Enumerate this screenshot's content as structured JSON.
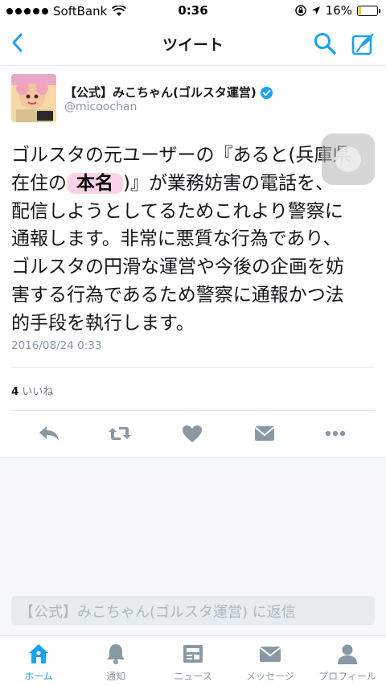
{
  "status_bar": {
    "carrier": "SoftBank",
    "time": "0:36",
    "battery": "16%",
    "battery_level": 0.16
  },
  "nav": {
    "title": "ツイート"
  },
  "tweet": {
    "display_name": "【公式】みこちゃん(ゴルスタ運営)",
    "handle": "@micoochan",
    "line1": "ゴルスタの元ユーザーの『あると(兵庫県",
    "line2_a": "在住の",
    "line2_redacted": "本名",
    "line2_b": ")』が業務妨害の電話を、",
    "line3": "配信しようとしてるためこれより警察に",
    "line4": "通報します。非常に悪質な行為であり、",
    "line5": "ゴルスタの円滑な運営や今後の企画を妨",
    "line6": "害する行為であるため警察に通報かつ法",
    "line7": "的手段を執行します。",
    "timestamp": "2016/08/24 0:33",
    "like_count": "4",
    "like_label": "いいね"
  },
  "reply": {
    "placeholder": "【公式】みこちゃん(ゴルスタ運営) に返信"
  },
  "tabs": [
    {
      "label": "ホーム",
      "icon": "home-icon"
    },
    {
      "label": "通知",
      "icon": "bell-icon"
    },
    {
      "label": "ニュース",
      "icon": "news-icon"
    },
    {
      "label": "メッセージ",
      "icon": "envelope-icon"
    },
    {
      "label": "プロフィール",
      "icon": "person-icon"
    }
  ],
  "colors": {
    "accent": "#1da1f2",
    "icon_gray": "#8899a6",
    "redaction": "#fbd3e8"
  }
}
